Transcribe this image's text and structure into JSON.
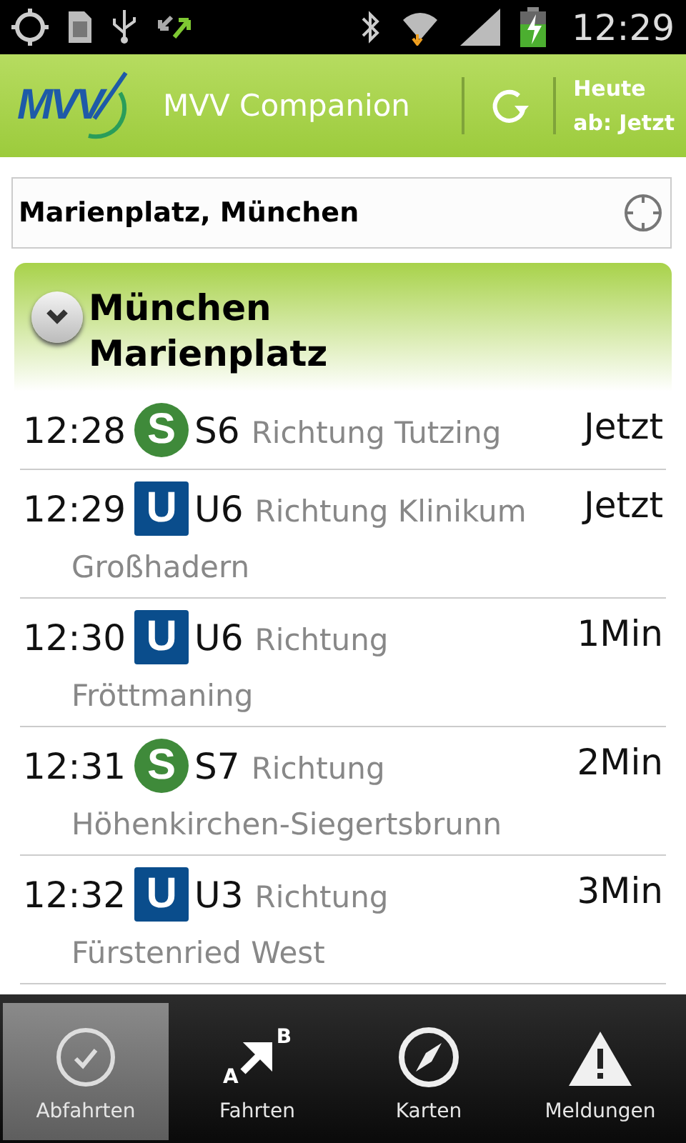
{
  "status_bar": {
    "time": "12:29"
  },
  "app_bar": {
    "logo_text": "MVV",
    "title": "MVV Companion",
    "time_filter": [
      "Heute",
      "ab: Jetzt"
    ]
  },
  "search": {
    "value": "Marienplatz, München"
  },
  "station": {
    "name": [
      "München",
      "Marienplatz"
    ],
    "expanded": true
  },
  "departures": [
    {
      "time": "12:28",
      "kind": "sbahn",
      "badge": "S",
      "line": "S6",
      "direction": "Richtung Tutzing",
      "wait": "Jetzt"
    },
    {
      "time": "12:29",
      "kind": "ubahn",
      "badge": "U",
      "line": "U6",
      "direction": "Richtung Klinikum Großhadern",
      "wait": "Jetzt"
    },
    {
      "time": "12:30",
      "kind": "ubahn",
      "badge": "U",
      "line": "U6",
      "direction": "Richtung Fröttmaning",
      "wait": "1Min"
    },
    {
      "time": "12:31",
      "kind": "sbahn",
      "badge": "S",
      "line": "S7",
      "direction": "Richtung Höhenkirchen-Siegertsbrunn",
      "wait": "2Min"
    },
    {
      "time": "12:32",
      "kind": "ubahn",
      "badge": "U",
      "line": "U3",
      "direction": "Richtung Fürstenried West",
      "wait": "3Min"
    }
  ],
  "tabs": [
    {
      "kind": "clock",
      "label": "Abfahrten",
      "selected": true
    },
    {
      "kind": "route",
      "label": "Fahrten",
      "selected": false,
      "icon_letters": [
        "A",
        "B"
      ]
    },
    {
      "kind": "compass",
      "label": "Karten",
      "selected": false
    },
    {
      "kind": "warning",
      "label": "Meldungen",
      "selected": false
    }
  ]
}
